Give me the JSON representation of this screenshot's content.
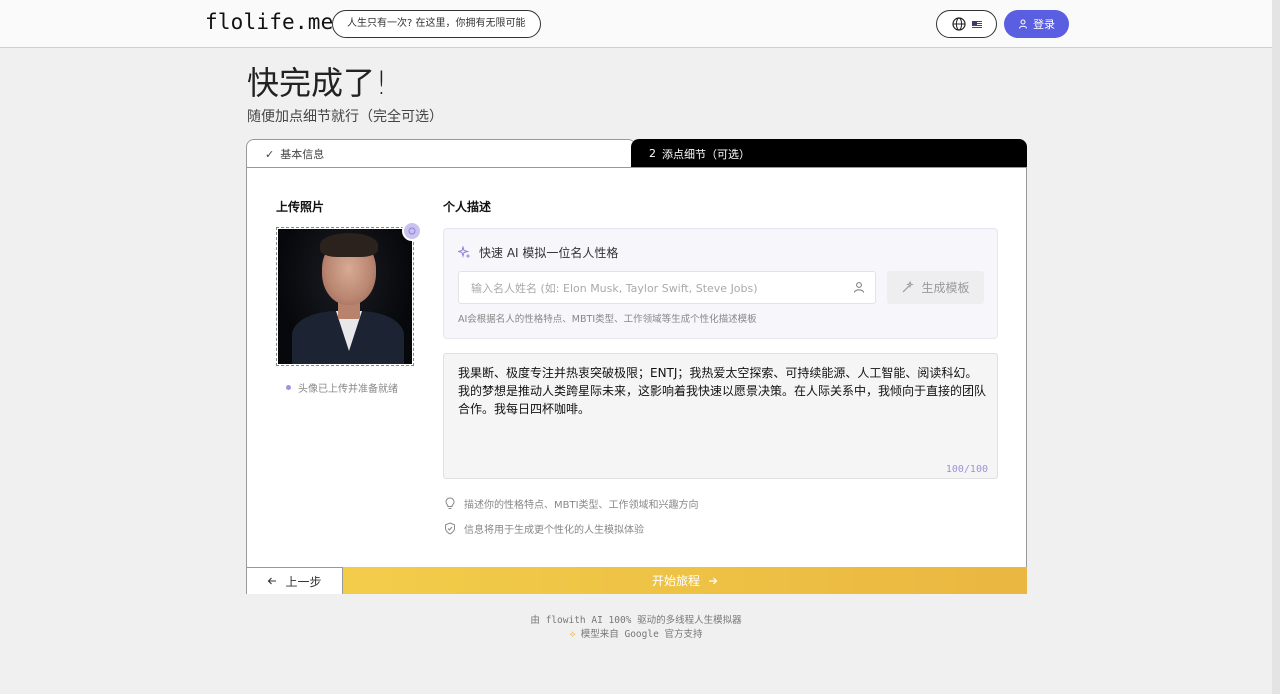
{
  "header": {
    "logo": "flolife.me",
    "tagline": "人生只有一次? 在这里，你拥有无限可能",
    "language_icon": "globe-icon",
    "language_flag": "🇺🇸",
    "login_label": "登录",
    "accent_color": "#5a5ee0"
  },
  "page": {
    "title": "快完成了!",
    "subtitle": "随便加点细节就行（完全可选）"
  },
  "steps": [
    {
      "label": "基本信息",
      "state": "done",
      "marker": "✓"
    },
    {
      "label": "添点细节（可选）",
      "state": "active",
      "marker": "2"
    }
  ],
  "upload": {
    "label": "上传照片",
    "status": "头像已上传并准备就绪"
  },
  "description": {
    "label": "个人描述",
    "ai": {
      "title": "快速 AI 模拟一位名人性格",
      "placeholder": "输入名人姓名 (如: Elon Musk, Taylor Swift, Steve Jobs)",
      "generate_label": "生成模板",
      "hint": "AI会根据名人的性格特点、MBTI类型、工作领域等生成个性化描述模板"
    },
    "text": "我果断、极度专注并热衷突破极限；ENTJ；我热爱太空探索、可持续能源、人工智能、阅读科幻。我的梦想是推动人类跨星际未来，这影响着我快速以愿景决策。在人际关系中，我倾向于直接的团队合作。我每日四杯咖啡。",
    "char_count": "100/100",
    "tips": [
      "描述你的性格特点、MBTI类型、工作领域和兴趣方向",
      "信息将用于生成更个性化的人生模拟体验"
    ]
  },
  "actions": {
    "back_label": "上一步",
    "start_label": "开始旅程",
    "start_color": "#f2cd4a"
  },
  "footer": {
    "line1": "由 flowith AI 100% 驱动的多线程人生模拟器",
    "line2": "模型来自 Google 官方支持"
  }
}
